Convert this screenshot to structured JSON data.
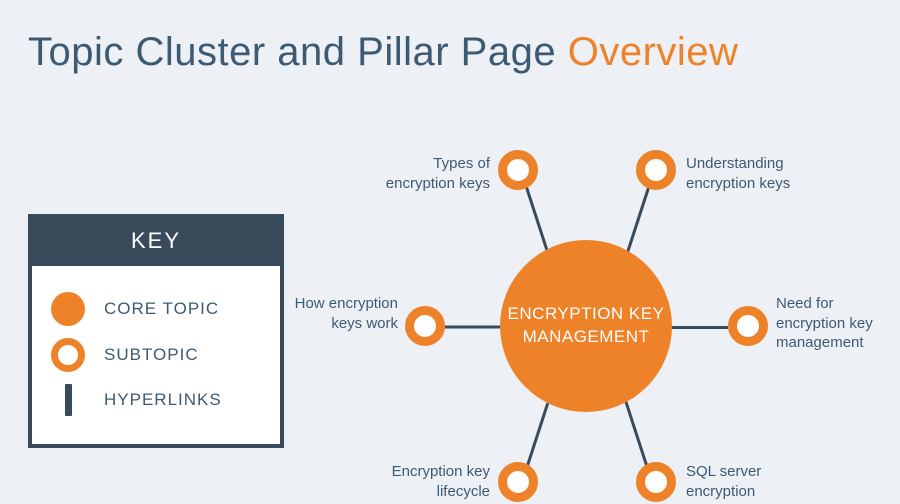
{
  "title": {
    "main": "Topic Cluster and Pillar Page ",
    "accent": "Overview"
  },
  "legend": {
    "header": "KEY",
    "core_topic": "CORE TOPIC",
    "subtopic": "SUBTOPIC",
    "hyperlinks": "HYPERLINKS"
  },
  "core_topic": "ENCRYPTION KEY MANAGEMENT",
  "subtopics": {
    "top_left": "Types of encryption keys",
    "top_right": "Understanding encryption keys",
    "left": "How encryption keys work",
    "right": "Need for encryption key management",
    "bottom_left": "Encryption key lifecycle",
    "bottom_right": "SQL server encryption"
  },
  "colors": {
    "accent": "#ed8229",
    "text": "#3d5a73",
    "dark": "#394a5a",
    "bg": "#edf0f5"
  }
}
